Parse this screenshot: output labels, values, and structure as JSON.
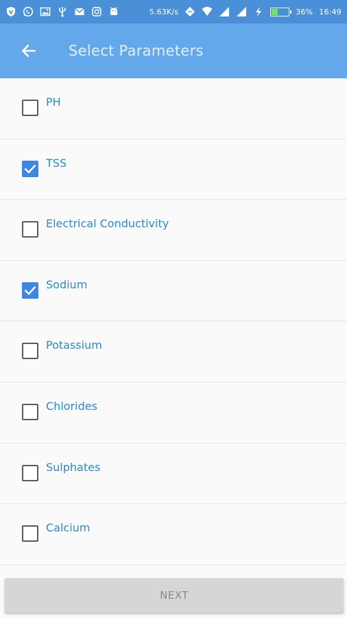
{
  "status_bar": {
    "network_speed": "5.63K/s",
    "battery_percent": "36%",
    "time": "16:49",
    "battery_level": 0.36,
    "left_icons": [
      "vpn-shield-icon",
      "whatsapp-icon",
      "gallery-icon",
      "usb-icon",
      "email-icon",
      "instagram-icon",
      "android-icon"
    ],
    "right_icons": [
      "sync-icon",
      "wifi-icon",
      "signal-icon",
      "signal-icon",
      "charging-icon",
      "battery-icon"
    ]
  },
  "app_bar": {
    "title": "Select Parameters",
    "back_icon": "arrow-back-icon",
    "background_color": "#64a8ec"
  },
  "parameters": [
    {
      "label": "PH",
      "checked": false
    },
    {
      "label": "TSS",
      "checked": true
    },
    {
      "label": "Electrical Conductivity",
      "checked": false
    },
    {
      "label": "Sodium",
      "checked": true
    },
    {
      "label": "Potassium",
      "checked": false
    },
    {
      "label": "Chlorides",
      "checked": false
    },
    {
      "label": "Sulphates",
      "checked": false
    },
    {
      "label": "Calcium",
      "checked": false
    }
  ],
  "footer": {
    "next_label": "NEXT"
  },
  "colors": {
    "accent": "#3d86e6",
    "label_text": "#2a8ad8",
    "status_bar": "#4a90d9"
  }
}
